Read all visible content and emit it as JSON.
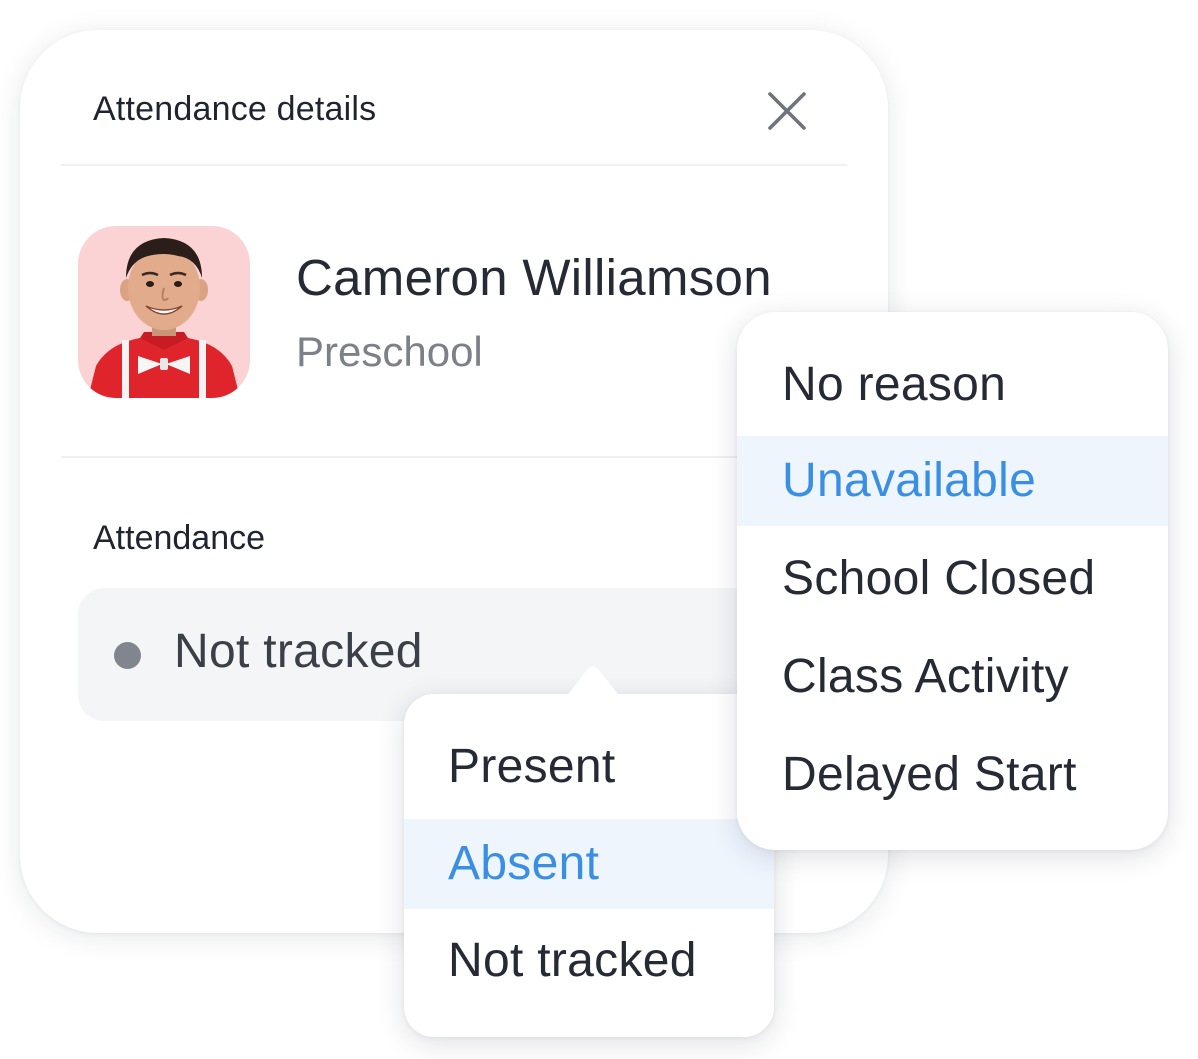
{
  "panel": {
    "title": "Attendance details",
    "close_icon": "close-icon"
  },
  "student": {
    "name": "Cameron Williamson",
    "class": "Preschool",
    "avatar_bg": "#fbd3d4"
  },
  "attendance": {
    "label": "Attendance",
    "current_value": "Not tracked",
    "status_dot_color": "#80858e"
  },
  "status_menu": {
    "items": [
      "Present",
      "Absent",
      "Not tracked"
    ],
    "selected": "Absent"
  },
  "reason_menu": {
    "items": [
      "No reason",
      "Unavailable",
      "School Closed",
      "Class Activity",
      "Delayed Start"
    ],
    "selected": "Unavailable"
  },
  "colors": {
    "accent": "#3a8fe3",
    "selected_bg": "#eef5fd",
    "text_primary": "#262a35",
    "text_secondary": "#7b8089"
  }
}
